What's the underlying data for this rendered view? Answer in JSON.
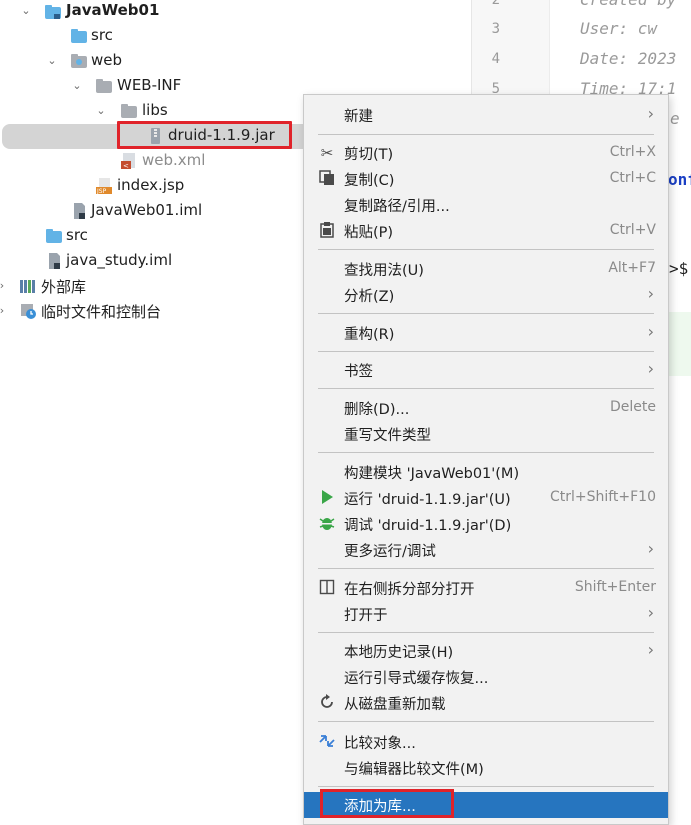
{
  "tree": {
    "project": "JavaWeb01",
    "items": [
      {
        "label": "src"
      },
      {
        "label": "web"
      },
      {
        "label": "WEB-INF"
      },
      {
        "label": "libs"
      },
      {
        "label": "druid-1.1.9.jar"
      },
      {
        "label": "web.xml"
      },
      {
        "label": "index.jsp"
      },
      {
        "label": "JavaWeb01.iml"
      },
      {
        "label": "src"
      },
      {
        "label": "java_study.iml"
      },
      {
        "label": "外部库"
      },
      {
        "label": "临时文件和控制台"
      }
    ]
  },
  "editor": {
    "lines": [
      {
        "num": "2",
        "text": "Created by"
      },
      {
        "num": "3",
        "text": "User: cw"
      },
      {
        "num": "4",
        "text": "Date: 2023"
      },
      {
        "num": "5",
        "text": "Time: 17:1"
      }
    ],
    "fragment_e": "e",
    "fragment_onf": "onf",
    "fragment_dollar": ">$"
  },
  "menu": {
    "items": [
      {
        "label": "新建",
        "shortcut": "",
        "submenu": true
      },
      {
        "label": "剪切(T)",
        "shortcut": "Ctrl+X",
        "icon": "cut-icon"
      },
      {
        "label": "复制(C)",
        "shortcut": "Ctrl+C",
        "icon": "copy-icon"
      },
      {
        "label": "复制路径/引用...",
        "shortcut": ""
      },
      {
        "label": "粘贴(P)",
        "shortcut": "Ctrl+V",
        "icon": "paste-icon"
      },
      {
        "label": "查找用法(U)",
        "shortcut": "Alt+F7"
      },
      {
        "label": "分析(Z)",
        "shortcut": "",
        "submenu": true
      },
      {
        "label": "重构(R)",
        "shortcut": "",
        "submenu": true
      },
      {
        "label": "书签",
        "shortcut": "",
        "submenu": true
      },
      {
        "label": "删除(D)...",
        "shortcut": "Delete"
      },
      {
        "label": "重写文件类型",
        "shortcut": ""
      },
      {
        "label": "构建模块 'JavaWeb01'(M)",
        "shortcut": ""
      },
      {
        "label": "运行 'druid-1.1.9.jar'(U)",
        "shortcut": "Ctrl+Shift+F10",
        "icon": "run-icon"
      },
      {
        "label": "调试 'druid-1.1.9.jar'(D)",
        "shortcut": "",
        "icon": "debug-icon"
      },
      {
        "label": "更多运行/调试",
        "shortcut": "",
        "submenu": true
      },
      {
        "label": "在右侧拆分部分打开",
        "shortcut": "Shift+Enter",
        "icon": "split-icon"
      },
      {
        "label": "打开于",
        "shortcut": "",
        "submenu": true
      },
      {
        "label": "本地历史记录(H)",
        "shortcut": "",
        "submenu": true
      },
      {
        "label": "运行引导式缓存恢复...",
        "shortcut": ""
      },
      {
        "label": "从磁盘重新加载",
        "shortcut": "",
        "icon": "reload-icon"
      },
      {
        "label": "比较对象...",
        "shortcut": "",
        "icon": "compare-icon"
      },
      {
        "label": "与编辑器比较文件(M)",
        "shortcut": ""
      },
      {
        "label": "添加为库...",
        "shortcut": ""
      }
    ]
  },
  "colors": {
    "active_item": "#2675bf",
    "highlight_box": "#e0232a",
    "folder_blue": "#62b3e6",
    "run_green": "#3aa648",
    "code_blue": "#1a3fc4"
  }
}
